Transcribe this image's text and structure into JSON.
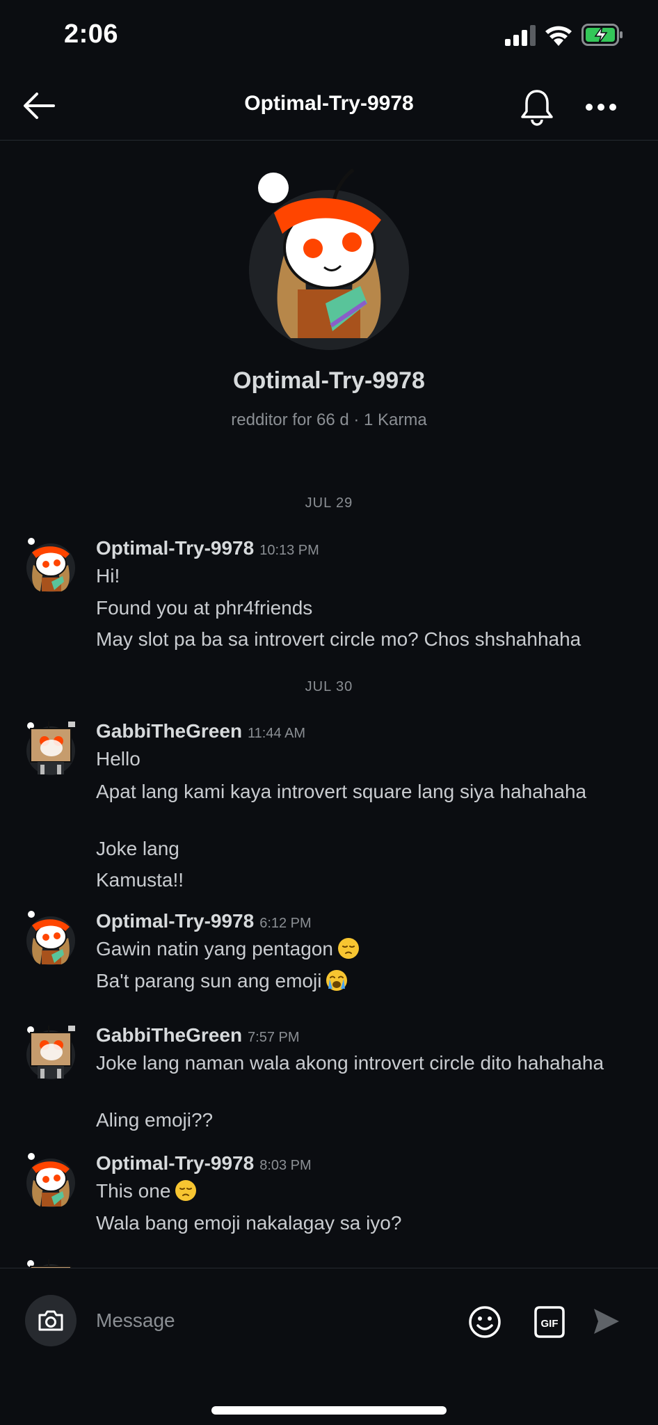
{
  "status_bar": {
    "time": "2:06"
  },
  "header": {
    "title": "Optimal-Try-9978"
  },
  "profile": {
    "name": "Optimal-Try-9978",
    "meta": "redditor for 66 d · 1 Karma"
  },
  "chat": {
    "date_1": "JUL 29",
    "date_2": "JUL 30",
    "groups": [
      {
        "author": "Optimal-Try-9978",
        "time": "10:13 PM",
        "lines": [
          "Hi!",
          "Found you at phr4friends",
          "May slot pa ba sa introvert circle mo? Chos shshahhaha"
        ]
      },
      {
        "author": "GabbiTheGreen",
        "time": "11:44 AM",
        "lines": [
          "Hello",
          "Apat lang kami kaya introvert square lang siya hahahaha",
          "Joke lang",
          "Kamusta!!"
        ]
      },
      {
        "author": "Optimal-Try-9978",
        "time": "6:12 PM",
        "lines": [
          "Gawin natin yang pentagon",
          "Ba't parang sun ang emoji"
        ]
      },
      {
        "author": "GabbiTheGreen",
        "time": "7:57 PM",
        "lines": [
          "Joke lang naman wala akong introvert circle dito hahahaha",
          "Aling emoji??"
        ]
      },
      {
        "author": "Optimal-Try-9978",
        "time": "8:03 PM",
        "lines": [
          "This one",
          "Wala bang emoji nakalagay sa iyo?"
        ]
      }
    ]
  },
  "composer": {
    "placeholder": "Message",
    "gif_label": "GIF"
  },
  "icons": {
    "back": "arrow-left-icon",
    "bell": "bell-icon",
    "more": "more-horizontal-icon",
    "camera": "camera-icon",
    "emoji": "smiley-icon",
    "gif": "gif-icon",
    "send": "send-icon"
  },
  "colors": {
    "background": "#0b0d11",
    "accent_orange": "#ff4500",
    "text": "#d7dadc",
    "muted": "#8b8f94"
  }
}
